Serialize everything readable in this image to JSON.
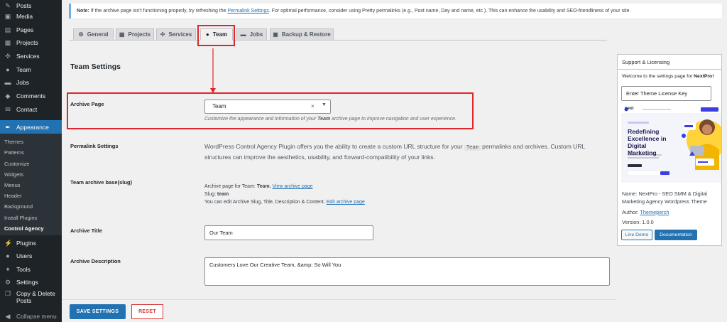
{
  "sidebar": {
    "items": [
      {
        "label": "Posts",
        "icon": "pin-icon"
      },
      {
        "label": "Media",
        "icon": "media-icon"
      },
      {
        "label": "Pages",
        "icon": "pages-icon"
      },
      {
        "label": "Projects",
        "icon": "projects-icon"
      },
      {
        "label": "Services",
        "icon": "services-icon"
      },
      {
        "label": "Team",
        "icon": "team-icon"
      },
      {
        "label": "Jobs",
        "icon": "jobs-icon"
      },
      {
        "label": "Comments",
        "icon": "comments-icon"
      },
      {
        "label": "Contact",
        "icon": "contact-icon"
      },
      {
        "label": "Appearance",
        "icon": "appearance-icon"
      }
    ],
    "submenu": [
      "Themes",
      "Patterns",
      "Customize",
      "Widgets",
      "Menus",
      "Header",
      "Background",
      "Install Plugins",
      "Control Agency"
    ],
    "bottom_items": [
      {
        "label": "Plugins",
        "icon": "plugins-icon"
      },
      {
        "label": "Users",
        "icon": "users-icon"
      },
      {
        "label": "Tools",
        "icon": "tools-icon"
      },
      {
        "label": "Settings",
        "icon": "settings-icon"
      },
      {
        "label": "Copy & Delete",
        "label2": "Posts",
        "icon": "copy-icon"
      },
      {
        "label": "Collapse menu",
        "icon": "collapse-icon"
      }
    ]
  },
  "notice": {
    "prefix": "Note:",
    "text_before": " If the archive page isn't functioning properly, try refreshing the ",
    "link": "Permalink Settings",
    "text_after": ". For optimal performance, consider using Pretty permalinks (e.g., Post name, Day and name, etc.). This can enhance the usability and SEO-friendliness of your site."
  },
  "tabs": [
    {
      "label": "General",
      "icon": "gear-icon"
    },
    {
      "label": "Projects",
      "icon": "projects-icon"
    },
    {
      "label": "Services",
      "icon": "services-icon"
    },
    {
      "label": "Team",
      "icon": "team-icon"
    },
    {
      "label": "Jobs",
      "icon": "jobs-icon"
    },
    {
      "label": "Backup & Restore",
      "icon": "backup-icon"
    }
  ],
  "active_tab": "Team",
  "settings": {
    "title": "Team Settings",
    "archive_page": {
      "label": "Archive Page",
      "value": "Team",
      "clear": "×",
      "desc_before": "Customize the appearance and information of your ",
      "desc_bold": "Team",
      "desc_after": " archive page to improve navigation and user experience."
    },
    "permalink": {
      "label": "Permalink Settings",
      "text_before": "WordPress Control Agency Plugin offers you the ability to create a custom URL structure for your ",
      "code": "Team",
      "text_after": " permalinks and archives. Custom URL structures can improve the aesthetics, usability, and forward-compatibility of your links."
    },
    "slug": {
      "label": "Team archive base(slug)",
      "line1_before": "Archive page for Team: ",
      "line1_bold": "Team.",
      "line1_link": "View archive page",
      "line2_before": "Slug: ",
      "line2_bold": "team",
      "line3_before": "You can edit Archive Slug, Title, Description & Content. ",
      "line3_link": "Edit archive page"
    },
    "archive_title": {
      "label": "Archive Title",
      "value": "Our Team"
    },
    "archive_description": {
      "label": "Archive Description",
      "value": "Customers Love Our Creative Team, &amp; So Will You"
    }
  },
  "buttons": {
    "save": "SAVE SETTINGS",
    "reset": "RESET"
  },
  "support": {
    "title": "Support & Licensing",
    "welcome_before": "Welcome to the settings page for ",
    "welcome_bold": "NextPro!",
    "license_placeholder": "Enter Theme License Key",
    "thumb": {
      "logo": "next",
      "headline": [
        "Redefining",
        "Excellence in",
        "Digital",
        "Marketing"
      ]
    },
    "name": "Name: NextPro - SEO SMM & Digital Marketing Agency Wordpress Theme",
    "author_label": "Author: ",
    "author_link": "Themeperch",
    "version": "Version: 1.0.0",
    "live_demo": "Live Demo",
    "documentation": "Documentation"
  },
  "colors": {
    "accent": "#2271b1",
    "highlight": "#e0252b",
    "sidebar": "#1d2327"
  }
}
